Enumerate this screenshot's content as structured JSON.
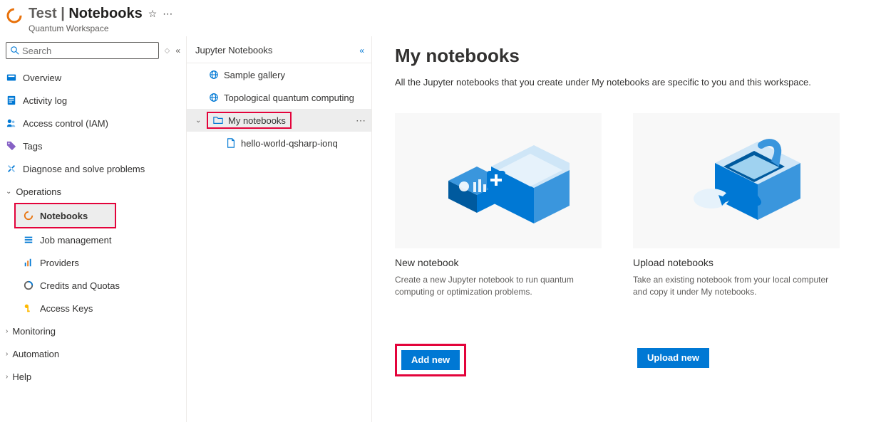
{
  "header": {
    "title_prefix": "Test",
    "title_sep": " | ",
    "title_page": "Notebooks",
    "subtitle": "Quantum Workspace"
  },
  "search": {
    "placeholder": "Search"
  },
  "nav": {
    "overview": "Overview",
    "activity": "Activity log",
    "iam": "Access control (IAM)",
    "tags": "Tags",
    "diagnose": "Diagnose and solve problems",
    "operations": "Operations",
    "notebooks": "Notebooks",
    "jobmgmt": "Job management",
    "providers": "Providers",
    "credits": "Credits and Quotas",
    "keys": "Access Keys",
    "monitoring": "Monitoring",
    "automation": "Automation",
    "help": "Help"
  },
  "tree": {
    "header": "Jupyter Notebooks",
    "sample": "Sample gallery",
    "topo": "Topological quantum computing",
    "mynb": "My notebooks",
    "hello": "hello-world-qsharp-ionq"
  },
  "main": {
    "title": "My notebooks",
    "desc": "All the Jupyter notebooks that you create under My notebooks are specific to you and this workspace.",
    "card1": {
      "title": "New notebook",
      "text": "Create a new Jupyter notebook to run quantum computing or optimization problems.",
      "button": "Add new"
    },
    "card2": {
      "title": "Upload notebooks",
      "text": "Take an existing notebook from your local computer and copy it under My notebooks.",
      "button": "Upload new"
    }
  }
}
